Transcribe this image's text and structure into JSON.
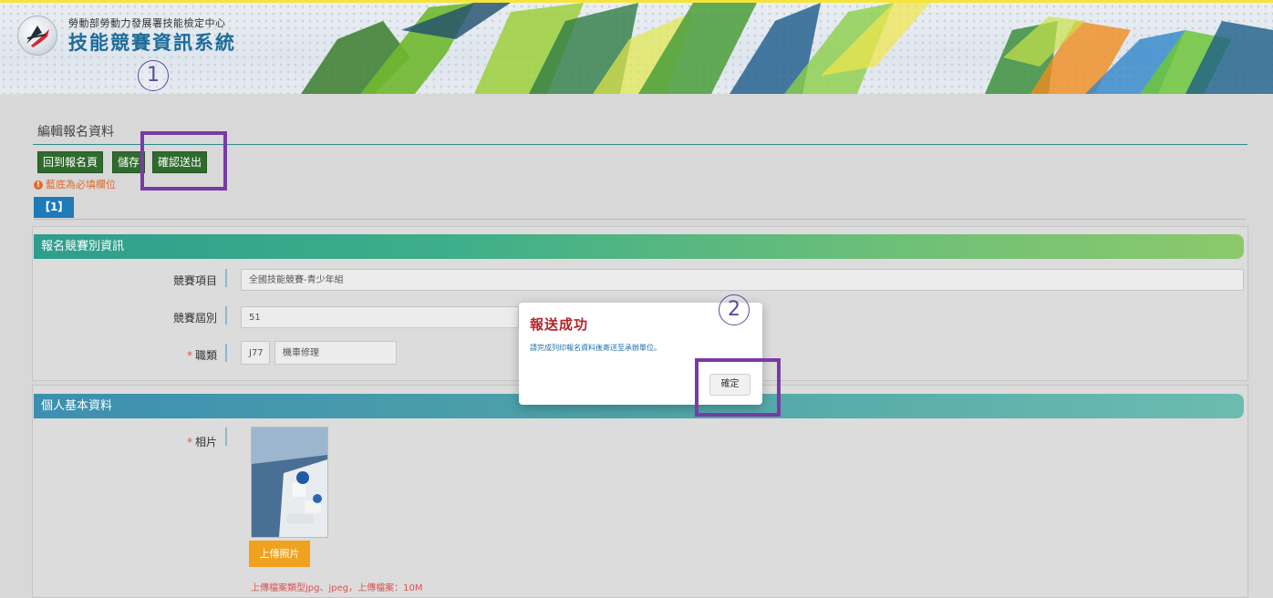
{
  "header": {
    "org_name": "勞動部勞動力發展署技能檢定中心",
    "system_name": "技能競賽資訊系統"
  },
  "annotations": {
    "step1": "1",
    "step2": "2"
  },
  "page": {
    "title": "編輯報名資料",
    "buttons": {
      "back": "回到報名頁",
      "save": "儲存",
      "submit": "確認送出"
    },
    "required_note": "藍底為必填欄位",
    "tab_label": "【1】"
  },
  "section_competition": {
    "heading": "報名競賽別資訊",
    "item_label": "競賽項目",
    "item_value": "全國技能競賽-青少年組",
    "session_label": "競賽屆別",
    "session_value": "51",
    "trade_label": "職類",
    "trade_code": "J77",
    "trade_name": "機車修理"
  },
  "section_personal": {
    "heading": "個人基本資料",
    "photo_label": "相片",
    "upload_button": "上傳照片",
    "upload_hint": "上傳檔案類型jpg、jpeg，上傳檔案：10M"
  },
  "dialog": {
    "title": "報送成功",
    "message": "請完成列印報名資料後寄送至承辦單位。",
    "ok_label": "確定"
  },
  "colors": {
    "highlight": "#7a3aa6",
    "button_green": "#2f6b2d",
    "tab_blue": "#1e7ab8",
    "dialog_title": "#b5232a"
  }
}
